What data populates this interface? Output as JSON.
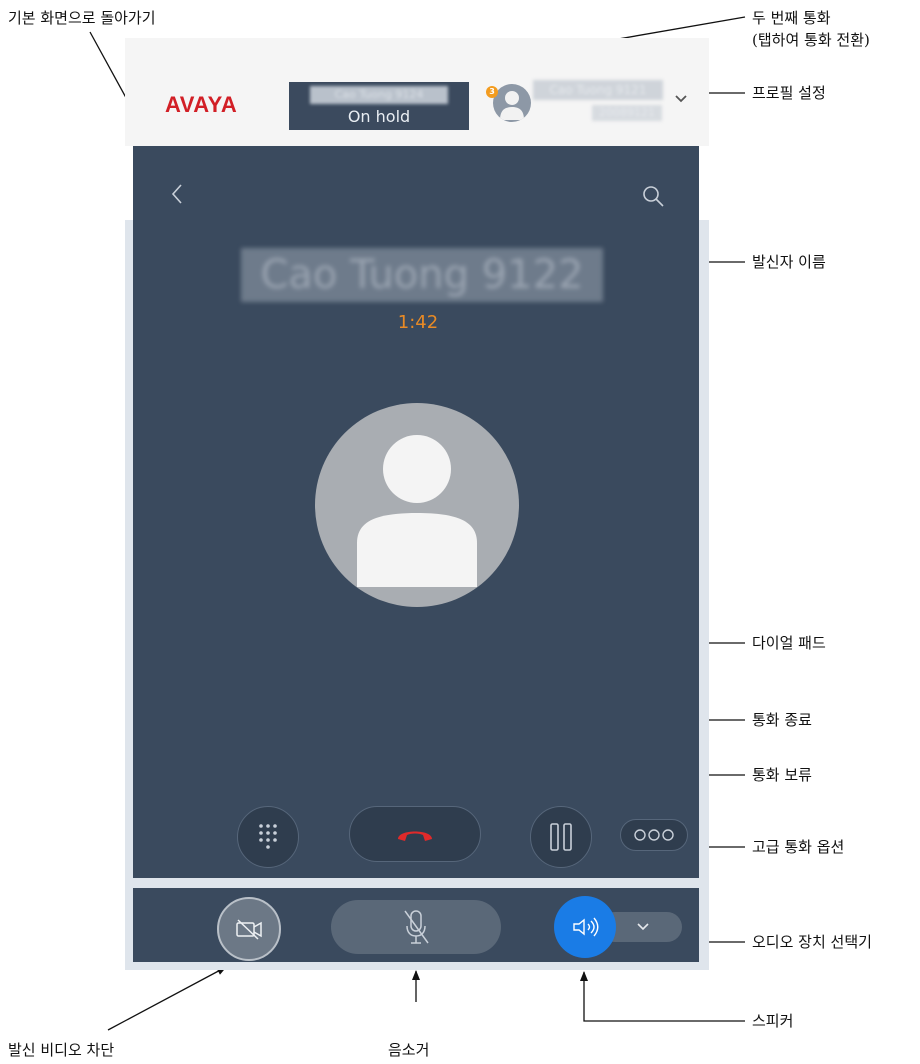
{
  "header": {
    "logo_text": "AVAYA",
    "held_call": {
      "name": "Cao Tuong 9124",
      "status": "On hold"
    },
    "profile": {
      "badge": "3",
      "name": "Cao Tuong 9121",
      "extension": "20089121"
    }
  },
  "call": {
    "caller_name": "Cao Tuong 9122",
    "timer": "1:42"
  },
  "icons": {
    "back": "chevron-left-icon",
    "search": "search-icon",
    "dialpad": "dialpad-icon",
    "end_call": "phone-hangup-icon",
    "hold": "pause-icon",
    "more": "more-options-icon",
    "video_block": "video-off-icon",
    "mute": "microphone-off-icon",
    "speaker": "speaker-icon",
    "audio_device": "chevron-down-icon"
  },
  "colors": {
    "panel": "#3a4a5e",
    "end_call": "#e02a2a",
    "speaker_active": "#1a7ce6",
    "timer": "#e88a25",
    "logo": "#d21f26"
  },
  "annotations": {
    "go_home": "기본 화면으로 돌아가기",
    "second_call_line1": "두 번째 통화",
    "second_call_line2": "(탭하여 통화 전환)",
    "profile_settings": "프로필 설정",
    "caller_name": "발신자 이름",
    "dial_pad": "다이얼 패드",
    "end_call": "통화 종료",
    "hold_call": "통화 보류",
    "advanced_options": "고급 통화 옵션",
    "audio_device": "오디오 장치 선택기",
    "speaker": "스피커",
    "mute": "음소거",
    "block_video": "발신 비디오 차단"
  }
}
